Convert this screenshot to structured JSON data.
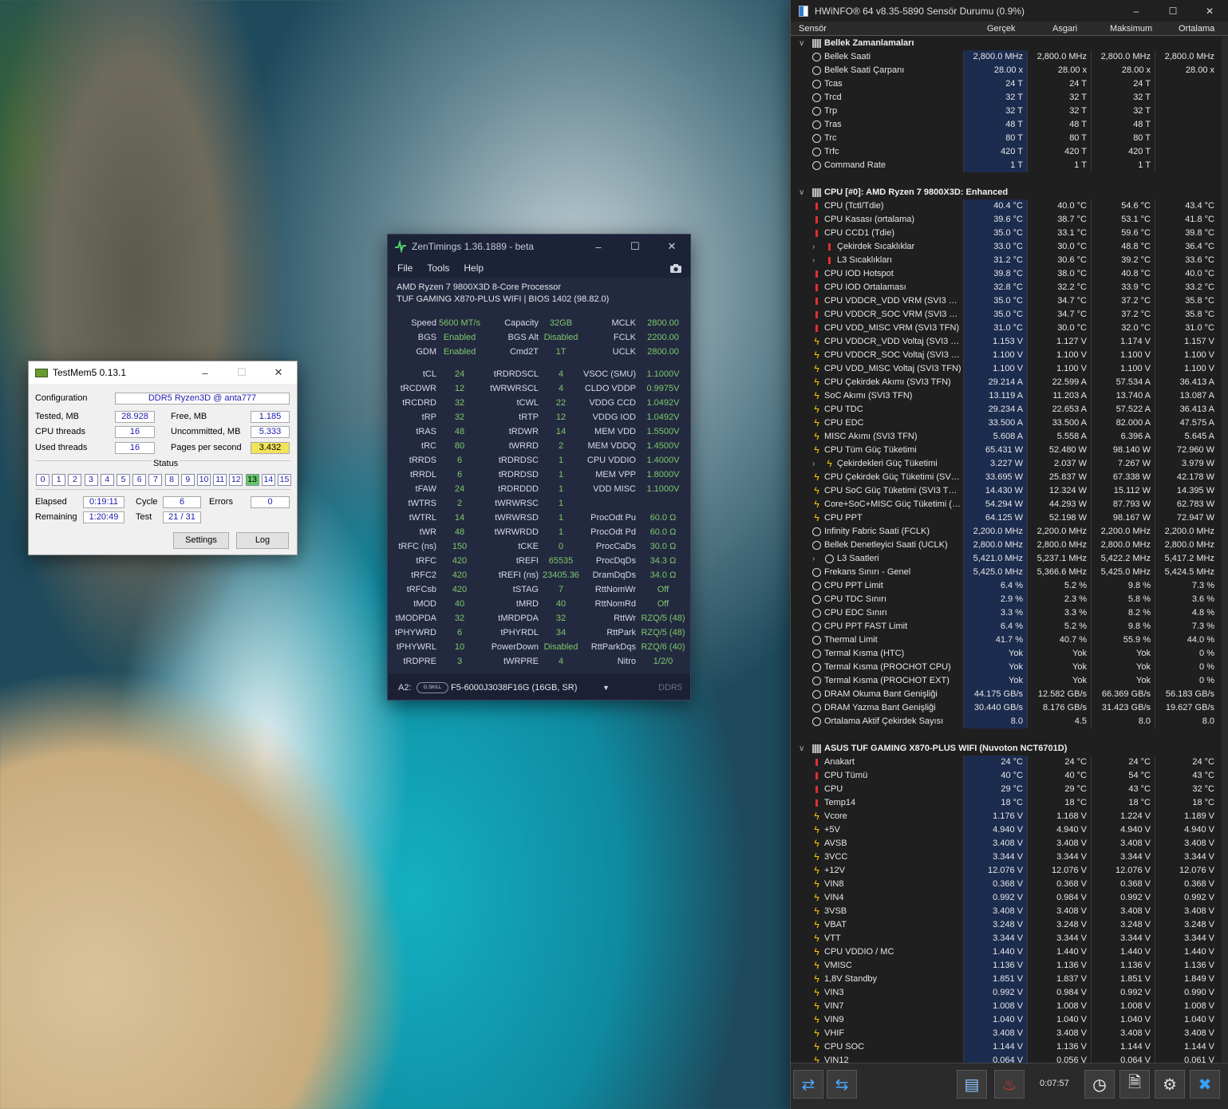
{
  "testmem": {
    "title": "TestMem5  0.13.1",
    "configuration_label": "Configuration",
    "configuration_value": "DDR5 Ryzen3D @ anta777",
    "tested_label": "Tested, MB",
    "tested_value": "28.928",
    "free_label": "Free, MB",
    "free_value": "1.185",
    "cpu_threads_label": "CPU threads",
    "cpu_threads_value": "16",
    "uncommitted_label": "Uncommitted, MB",
    "uncommitted_value": "5.333",
    "used_threads_label": "Used threads",
    "used_threads_value": "16",
    "pages_label": "Pages per second",
    "pages_value": "3.432",
    "status_label": "Status",
    "status_cells": [
      "0",
      "1",
      "2",
      "3",
      "4",
      "5",
      "6",
      "7",
      "8",
      "9",
      "10",
      "11",
      "12",
      "13",
      "14",
      "15"
    ],
    "active_cell": "13",
    "elapsed_label": "Elapsed",
    "elapsed_value": "0:19:11",
    "cycle_label": "Cycle",
    "cycle_value": "6",
    "errors_label": "Errors",
    "errors_value": "0",
    "remaining_label": "Remaining",
    "remaining_value": "1:20:49",
    "test_label": "Test",
    "test_value": "21 / 31",
    "settings_button": "Settings",
    "log_button": "Log"
  },
  "zen": {
    "title": "ZenTimings 1.36.1889 - beta",
    "menu": [
      "File",
      "Tools",
      "Help"
    ],
    "cpu": "AMD Ryzen 7 9800X3D 8-Core Processor",
    "board": "TUF GAMING X870-PLUS WIFI | BIOS 1402 (98.82.0)",
    "top_rows": [
      [
        "Speed",
        "5600 MT/s",
        "Capacity",
        "32GB",
        "MCLK",
        "2800.00"
      ],
      [
        "BGS",
        "Enabled",
        "BGS Alt",
        "Disabled",
        "FCLK",
        "2200.00"
      ],
      [
        "GDM",
        "Enabled",
        "Cmd2T",
        "1T",
        "UCLK",
        "2800.00"
      ]
    ],
    "rows": [
      [
        "tCL",
        "24",
        "tRDRDSCL",
        "4",
        "VSOC (SMU)",
        "1.1000V"
      ],
      [
        "tRCDWR",
        "12",
        "tWRWRSCL",
        "4",
        "CLDO VDDP",
        "0.9975V"
      ],
      [
        "tRCDRD",
        "32",
        "tCWL",
        "22",
        "VDDG CCD",
        "1.0492V"
      ],
      [
        "tRP",
        "32",
        "tRTP",
        "12",
        "VDDG IOD",
        "1.0492V"
      ],
      [
        "tRAS",
        "48",
        "tRDWR",
        "14",
        "MEM VDD",
        "1.5500V"
      ],
      [
        "tRC",
        "80",
        "tWRRD",
        "2",
        "MEM VDDQ",
        "1.4500V"
      ],
      [
        "tRRDS",
        "6",
        "tRDRDSC",
        "1",
        "CPU VDDIO",
        "1.4000V"
      ],
      [
        "tRRDL",
        "6",
        "tRDRDSD",
        "1",
        "MEM VPP",
        "1.8000V"
      ],
      [
        "tFAW",
        "24",
        "tRDRDDD",
        "1",
        "VDD MISC",
        "1.1000V"
      ],
      [
        "tWTRS",
        "2",
        "tWRWRSC",
        "1",
        "",
        ""
      ],
      [
        "tWTRL",
        "14",
        "tWRWRSD",
        "1",
        "ProcOdt Pu",
        "60.0 Ω"
      ],
      [
        "tWR",
        "48",
        "tWRWRDD",
        "1",
        "ProcOdt Pd",
        "60.0 Ω"
      ],
      [
        "tRFC (ns)",
        "150",
        "tCKE",
        "0",
        "ProcCaDs",
        "30.0 Ω"
      ],
      [
        "tRFC",
        "420",
        "tREFI",
        "65535",
        "ProcDqDs",
        "34.3 Ω"
      ],
      [
        "tRFC2",
        "420",
        "tREFI (ns)",
        "23405.36",
        "DramDqDs",
        "34.0 Ω"
      ],
      [
        "tRFCsb",
        "420",
        "tSTAG",
        "7",
        "RttNomWr",
        "Off"
      ],
      [
        "tMOD",
        "40",
        "tMRD",
        "40",
        "RttNomRd",
        "Off"
      ],
      [
        "tMODPDA",
        "32",
        "tMRDPDA",
        "32",
        "RttWr",
        "RZQ/5 (48)"
      ],
      [
        "tPHYWRD",
        "6",
        "tPHYRDL",
        "34",
        "RttPark",
        "RZQ/5 (48)"
      ],
      [
        "tPHYWRL",
        "10",
        "PowerDown",
        "Disabled",
        "RttParkDqs",
        "RZQ/6 (40)"
      ],
      [
        "tRDPRE",
        "3",
        "tWRPRE",
        "4",
        "Nitro",
        "1/2/0"
      ]
    ],
    "slot": "A2:",
    "brand": "G.SKILL",
    "module": "F5-6000J3038F16G (16GB, SR)",
    "memtype": "DDR5"
  },
  "hwinfo": {
    "title": "HWiNFO® 64 v8.35-5890 Sensör Durumu (0.9%)",
    "headers": [
      "Sensör",
      "Gerçek",
      "Asgari",
      "Maksimum",
      "Ortalama"
    ],
    "timer": "0:07:57",
    "rows": [
      {
        "t": "g",
        "n": "Bellek Zamanlamaları"
      },
      {
        "t": "c",
        "n": "Bellek Saati",
        "v": [
          "2,800.0 MHz",
          "2,800.0 MHz",
          "2,800.0 MHz",
          "2,800.0 MHz"
        ]
      },
      {
        "t": "c",
        "n": "Bellek Saati Çarpanı",
        "v": [
          "28.00 x",
          "28.00 x",
          "28.00 x",
          "28.00 x"
        ]
      },
      {
        "t": "c",
        "n": "Tcas",
        "v": [
          "24 T",
          "24 T",
          "24 T",
          ""
        ]
      },
      {
        "t": "c",
        "n": "Trcd",
        "v": [
          "32 T",
          "32 T",
          "32 T",
          ""
        ]
      },
      {
        "t": "c",
        "n": "Trp",
        "v": [
          "32 T",
          "32 T",
          "32 T",
          ""
        ]
      },
      {
        "t": "c",
        "n": "Tras",
        "v": [
          "48 T",
          "48 T",
          "48 T",
          ""
        ]
      },
      {
        "t": "c",
        "n": "Trc",
        "v": [
          "80 T",
          "80 T",
          "80 T",
          ""
        ]
      },
      {
        "t": "c",
        "n": "Trfc",
        "v": [
          "420 T",
          "420 T",
          "420 T",
          ""
        ]
      },
      {
        "t": "c",
        "n": "Command Rate",
        "v": [
          "1 T",
          "1 T",
          "1 T",
          ""
        ]
      },
      {
        "t": "e"
      },
      {
        "t": "g",
        "n": "CPU [#0]: AMD Ryzen 7 9800X3D: Enhanced"
      },
      {
        "t": "h",
        "n": "CPU (Tctl/Tdie)",
        "v": [
          "40.4 °C",
          "40.0 °C",
          "54.6 °C",
          "43.4 °C"
        ]
      },
      {
        "t": "h",
        "n": "CPU Kasası (ortalama)",
        "v": [
          "39.6 °C",
          "38.7 °C",
          "53.1 °C",
          "41.8 °C"
        ]
      },
      {
        "t": "h",
        "n": "CPU CCD1 (Tdie)",
        "v": [
          "35.0 °C",
          "33.1 °C",
          "59.6 °C",
          "39.8 °C"
        ]
      },
      {
        "t": "h",
        "s": 1,
        "n": "Çekirdek Sıcaklıklar",
        "v": [
          "33.0 °C",
          "30.0 °C",
          "48.8 °C",
          "36.4 °C"
        ]
      },
      {
        "t": "h",
        "s": 1,
        "n": "L3 Sıcaklıkları",
        "v": [
          "31.2 °C",
          "30.6 °C",
          "39.2 °C",
          "33.6 °C"
        ]
      },
      {
        "t": "h",
        "n": "CPU IOD Hotspot",
        "v": [
          "39.8 °C",
          "38.0 °C",
          "40.8 °C",
          "40.0 °C"
        ]
      },
      {
        "t": "h",
        "n": "CPU IOD Ortalaması",
        "v": [
          "32.8 °C",
          "32.2 °C",
          "33.9 °C",
          "33.2 °C"
        ]
      },
      {
        "t": "h",
        "n": "CPU VDDCR_VDD VRM (SVI3 TFN)",
        "v": [
          "35.0 °C",
          "34.7 °C",
          "37.2 °C",
          "35.8 °C"
        ]
      },
      {
        "t": "h",
        "n": "CPU VDDCR_SOC VRM (SVI3 TFN)",
        "v": [
          "35.0 °C",
          "34.7 °C",
          "37.2 °C",
          "35.8 °C"
        ]
      },
      {
        "t": "h",
        "n": "CPU VDD_MISC VRM (SVI3 TFN)",
        "v": [
          "31.0 °C",
          "30.0 °C",
          "32.0 °C",
          "31.0 °C"
        ]
      },
      {
        "t": "b",
        "n": "CPU VDDCR_VDD Voltaj (SVI3 TFN)",
        "v": [
          "1.153 V",
          "1.127 V",
          "1.174 V",
          "1.157 V"
        ]
      },
      {
        "t": "b",
        "n": "CPU VDDCR_SOC Voltaj (SVI3 TFN)",
        "v": [
          "1.100 V",
          "1.100 V",
          "1.100 V",
          "1.100 V"
        ]
      },
      {
        "t": "b",
        "n": "CPU VDD_MISC Voltaj (SVI3 TFN)",
        "v": [
          "1.100 V",
          "1.100 V",
          "1.100 V",
          "1.100 V"
        ]
      },
      {
        "t": "b",
        "n": "CPU Çekirdek Akımı (SVI3 TFN)",
        "v": [
          "29.214 A",
          "22.599 A",
          "57.534 A",
          "36.413 A"
        ]
      },
      {
        "t": "b",
        "n": "SoC Akımı (SVI3 TFN)",
        "v": [
          "13.119 A",
          "11.203 A",
          "13.740 A",
          "13.087 A"
        ]
      },
      {
        "t": "b",
        "n": "CPU TDC",
        "v": [
          "29.234 A",
          "22.653 A",
          "57.522 A",
          "36.413 A"
        ]
      },
      {
        "t": "b",
        "n": "CPU EDC",
        "v": [
          "33.500 A",
          "33.500 A",
          "82.000 A",
          "47.575 A"
        ]
      },
      {
        "t": "b",
        "n": "MISC Akımı (SVI3 TFN)",
        "v": [
          "5.608 A",
          "5.558 A",
          "6.396 A",
          "5.645 A"
        ]
      },
      {
        "t": "b",
        "n": "CPU Tüm Güç Tüketimi",
        "v": [
          "65.431 W",
          "52.480 W",
          "98.140 W",
          "72.960 W"
        ]
      },
      {
        "t": "b",
        "s": 1,
        "n": "Çekirdekleri Güç Tüketimi",
        "v": [
          "3.227 W",
          "2.037 W",
          "7.267 W",
          "3.979 W"
        ]
      },
      {
        "t": "b",
        "n": "CPU Çekirdek Güç Tüketimi (SVI3 ...",
        "v": [
          "33.695 W",
          "25.837 W",
          "67.338 W",
          "42.178 W"
        ]
      },
      {
        "t": "b",
        "n": "CPU SoC Güç Tüketimi (SVI3 TFN)",
        "v": [
          "14.430 W",
          "12.324 W",
          "15.112 W",
          "14.395 W"
        ]
      },
      {
        "t": "b",
        "n": "Core+SoC+MISC Güç Tüketimi (S...",
        "v": [
          "54.294 W",
          "44.293 W",
          "87.793 W",
          "62.783 W"
        ]
      },
      {
        "t": "b",
        "n": "CPU PPT",
        "v": [
          "64.125 W",
          "52.198 W",
          "98.167 W",
          "72.947 W"
        ]
      },
      {
        "t": "c",
        "n": "Infinity Fabric Saati (FCLK)",
        "v": [
          "2,200.0 MHz",
          "2,200.0 MHz",
          "2,200.0 MHz",
          "2,200.0 MHz"
        ]
      },
      {
        "t": "c",
        "n": "Bellek Denetleyici Saati (UCLK)",
        "v": [
          "2,800.0 MHz",
          "2,800.0 MHz",
          "2,800.0 MHz",
          "2,800.0 MHz"
        ]
      },
      {
        "t": "c",
        "s": 1,
        "n": "L3 Saatleri",
        "v": [
          "5,421.0 MHz",
          "5,237.1 MHz",
          "5,422.2 MHz",
          "5,417.2 MHz"
        ]
      },
      {
        "t": "c",
        "n": "Frekans Sınırı - Genel",
        "v": [
          "5,425.0 MHz",
          "5,366.6 MHz",
          "5,425.0 MHz",
          "5,424.5 MHz"
        ]
      },
      {
        "t": "c",
        "n": "CPU PPT Limit",
        "v": [
          "6.4 %",
          "5.2 %",
          "9.8 %",
          "7.3 %"
        ]
      },
      {
        "t": "c",
        "n": "CPU TDC Sınırı",
        "v": [
          "2.9 %",
          "2.3 %",
          "5.8 %",
          "3.6 %"
        ]
      },
      {
        "t": "c",
        "n": "CPU EDC Sınırı",
        "v": [
          "3.3 %",
          "3.3 %",
          "8.2 %",
          "4.8 %"
        ]
      },
      {
        "t": "c",
        "n": "CPU PPT FAST Limit",
        "v": [
          "6.4 %",
          "5.2 %",
          "9.8 %",
          "7.3 %"
        ]
      },
      {
        "t": "c",
        "n": "Thermal Limit",
        "v": [
          "41.7 %",
          "40.7 %",
          "55.9 %",
          "44.0 %"
        ]
      },
      {
        "t": "c",
        "n": "Termal Kısma (HTC)",
        "v": [
          "Yok",
          "Yok",
          "Yok",
          "0 %"
        ]
      },
      {
        "t": "c",
        "n": "Termal Kısma (PROCHOT CPU)",
        "v": [
          "Yok",
          "Yok",
          "Yok",
          "0 %"
        ]
      },
      {
        "t": "c",
        "n": "Termal Kısma (PROCHOT EXT)",
        "v": [
          "Yok",
          "Yok",
          "Yok",
          "0 %"
        ]
      },
      {
        "t": "c",
        "n": "DRAM Okuma Bant Genişliği",
        "v": [
          "44.175 GB/s",
          "12.582 GB/s",
          "66.369 GB/s",
          "56.183 GB/s"
        ]
      },
      {
        "t": "c",
        "n": "DRAM Yazma Bant Genişliği",
        "v": [
          "30.440 GB/s",
          "8.176 GB/s",
          "31.423 GB/s",
          "19.627 GB/s"
        ]
      },
      {
        "t": "c",
        "n": "Ortalama Aktif Çekirdek Sayısı",
        "v": [
          "8.0",
          "4.5",
          "8.0",
          "8.0"
        ]
      },
      {
        "t": "e"
      },
      {
        "t": "g",
        "n": "ASUS TUF GAMING X870-PLUS WIFI (Nuvoton NCT6701D)"
      },
      {
        "t": "h",
        "n": "Anakart",
        "v": [
          "24 °C",
          "24 °C",
          "24 °C",
          "24 °C"
        ]
      },
      {
        "t": "h",
        "n": "CPU Tümü",
        "v": [
          "40 °C",
          "40 °C",
          "54 °C",
          "43 °C"
        ]
      },
      {
        "t": "h",
        "n": "CPU",
        "v": [
          "29 °C",
          "29 °C",
          "43 °C",
          "32 °C"
        ]
      },
      {
        "t": "h",
        "n": "Temp14",
        "v": [
          "18 °C",
          "18 °C",
          "18 °C",
          "18 °C"
        ]
      },
      {
        "t": "b",
        "n": "Vcore",
        "v": [
          "1.176 V",
          "1.168 V",
          "1.224 V",
          "1.189 V"
        ]
      },
      {
        "t": "b",
        "n": "+5V",
        "v": [
          "4.940 V",
          "4.940 V",
          "4.940 V",
          "4.940 V"
        ]
      },
      {
        "t": "b",
        "n": "AVSB",
        "v": [
          "3.408 V",
          "3.408 V",
          "3.408 V",
          "3.408 V"
        ]
      },
      {
        "t": "b",
        "n": "3VCC",
        "v": [
          "3.344 V",
          "3.344 V",
          "3.344 V",
          "3.344 V"
        ]
      },
      {
        "t": "b",
        "n": "+12V",
        "v": [
          "12.076 V",
          "12.076 V",
          "12.076 V",
          "12.076 V"
        ]
      },
      {
        "t": "b",
        "n": "VIN8",
        "v": [
          "0.368 V",
          "0.368 V",
          "0.368 V",
          "0.368 V"
        ]
      },
      {
        "t": "b",
        "n": "VIN4",
        "v": [
          "0.992 V",
          "0.984 V",
          "0.992 V",
          "0.992 V"
        ]
      },
      {
        "t": "b",
        "n": "3VSB",
        "v": [
          "3.408 V",
          "3.408 V",
          "3.408 V",
          "3.408 V"
        ]
      },
      {
        "t": "b",
        "n": "VBAT",
        "v": [
          "3.248 V",
          "3.248 V",
          "3.248 V",
          "3.248 V"
        ]
      },
      {
        "t": "b",
        "n": "VTT",
        "v": [
          "3.344 V",
          "3.344 V",
          "3.344 V",
          "3.344 V"
        ]
      },
      {
        "t": "b",
        "n": "CPU VDDIO / MC",
        "v": [
          "1.440 V",
          "1.440 V",
          "1.440 V",
          "1.440 V"
        ]
      },
      {
        "t": "b",
        "n": "VMISC",
        "v": [
          "1.136 V",
          "1.136 V",
          "1.136 V",
          "1.136 V"
        ]
      },
      {
        "t": "b",
        "n": "1,8V Standby",
        "v": [
          "1.851 V",
          "1.837 V",
          "1.851 V",
          "1.849 V"
        ]
      },
      {
        "t": "b",
        "n": "VIN3",
        "v": [
          "0.992 V",
          "0.984 V",
          "0.992 V",
          "0.990 V"
        ]
      },
      {
        "t": "b",
        "n": "VIN7",
        "v": [
          "1.008 V",
          "1.008 V",
          "1.008 V",
          "1.008 V"
        ]
      },
      {
        "t": "b",
        "n": "VIN9",
        "v": [
          "1.040 V",
          "1.040 V",
          "1.040 V",
          "1.040 V"
        ]
      },
      {
        "t": "b",
        "n": "VHIF",
        "v": [
          "3.408 V",
          "3.408 V",
          "3.408 V",
          "3.408 V"
        ]
      },
      {
        "t": "b",
        "n": "CPU SOC",
        "v": [
          "1.144 V",
          "1.136 V",
          "1.144 V",
          "1.144 V"
        ]
      },
      {
        "t": "b",
        "n": "VIN12",
        "v": [
          "0.064 V",
          "0.056 V",
          "0.064 V",
          "0.061 V"
        ]
      }
    ]
  }
}
